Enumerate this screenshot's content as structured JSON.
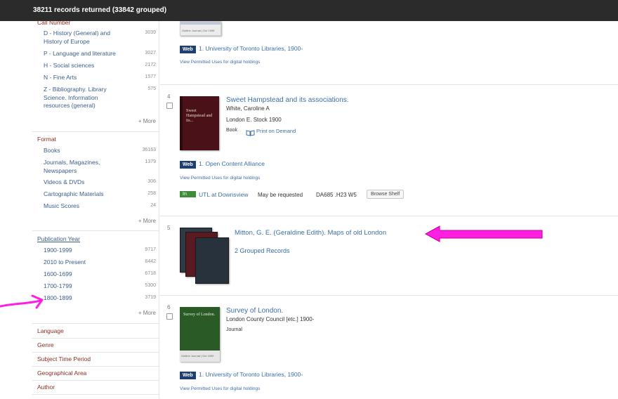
{
  "topbar": {
    "status": "38211 records returned (33842 grouped)"
  },
  "sidebar": {
    "call_number_heading": "Call Number",
    "call_items": [
      {
        "label": "D - History (General) and History of Europe",
        "count": "3039"
      },
      {
        "label": "P - Language and literature",
        "count": "3027"
      },
      {
        "label": "H - Social sciences",
        "count": "2172"
      },
      {
        "label": "N - Fine Arts",
        "count": "1577"
      },
      {
        "label": "Z - Bibliography. Library Science. Information resources (general)",
        "count": "575"
      }
    ],
    "more_label": "+ More",
    "format_heading": "Format",
    "format_items": [
      {
        "label": "Books",
        "count": "36163"
      },
      {
        "label": "Journals, Magazines, Newspapers",
        "count": "1379"
      },
      {
        "label": "Videos & DVDs",
        "count": "306"
      },
      {
        "label": "Cartographic Materials",
        "count": "258"
      },
      {
        "label": "Music Scores",
        "count": "24"
      }
    ],
    "pubyear_heading": "Publication Year",
    "pubyear_items": [
      {
        "label": "1900-1999",
        "count": "9717"
      },
      {
        "label": "2010 to Present",
        "count": "8442"
      },
      {
        "label": "1600-1699",
        "count": "6718"
      },
      {
        "label": "1700-1799",
        "count": "5300"
      },
      {
        "label": "1800-1899",
        "count": "3719"
      }
    ],
    "collapsed_headings": [
      "Language",
      "Genre",
      "Subject Time Period",
      "Geographical Area",
      "Author"
    ]
  },
  "results": {
    "top_record": {
      "cover_text": "Outline Journal | Oct 1999",
      "web_badge": "Web",
      "holding_link": "1. University of Toronto Libraries, 1900-",
      "permitted_uses": "View Permitted Uses for digital holdings"
    },
    "record4": {
      "number": "4",
      "cover_text": "Sweet Hampstead and its...",
      "title": "Sweet Hampstead and its associations.",
      "author": "White, Caroline A",
      "publication": "London E. Stock 1900",
      "format": "Book",
      "pod_label": "Print on Demand",
      "web_badge": "Web",
      "holding_link": "1. Open Content Alliance",
      "permitted_uses": "View Permitted Uses for digital holdings",
      "in_badge": "In",
      "location": "UTL at Downsview",
      "availability": "May be requested",
      "call_number": "DA685 .H23 W5",
      "browse_button": "Browse Shelf"
    },
    "record5": {
      "number": "5",
      "title": "Mitton, G. E. (Geraldine Edith). Maps of old London",
      "grouped": "2 Grouped Records"
    },
    "record6": {
      "number": "6",
      "cover_text": "Survey of London.",
      "cover_footer": "Outline Journal | Oct 1999",
      "title": "Survey of London.",
      "publication": "London County Council [etc.] 1900-",
      "format": "Journal",
      "web_badge": "Web",
      "holding_link": "1. University of Toronto Libraries, 1900-",
      "permitted_uses": "View Permitted Uses for digital holdings"
    }
  },
  "colors": {
    "annotation_magenta": "#ff1fe0",
    "facet_heading": "#8b2c21",
    "link_blue": "#3b6fa8",
    "web_badge": "#1f3f6e",
    "in_badge": "#3f8d3b"
  }
}
